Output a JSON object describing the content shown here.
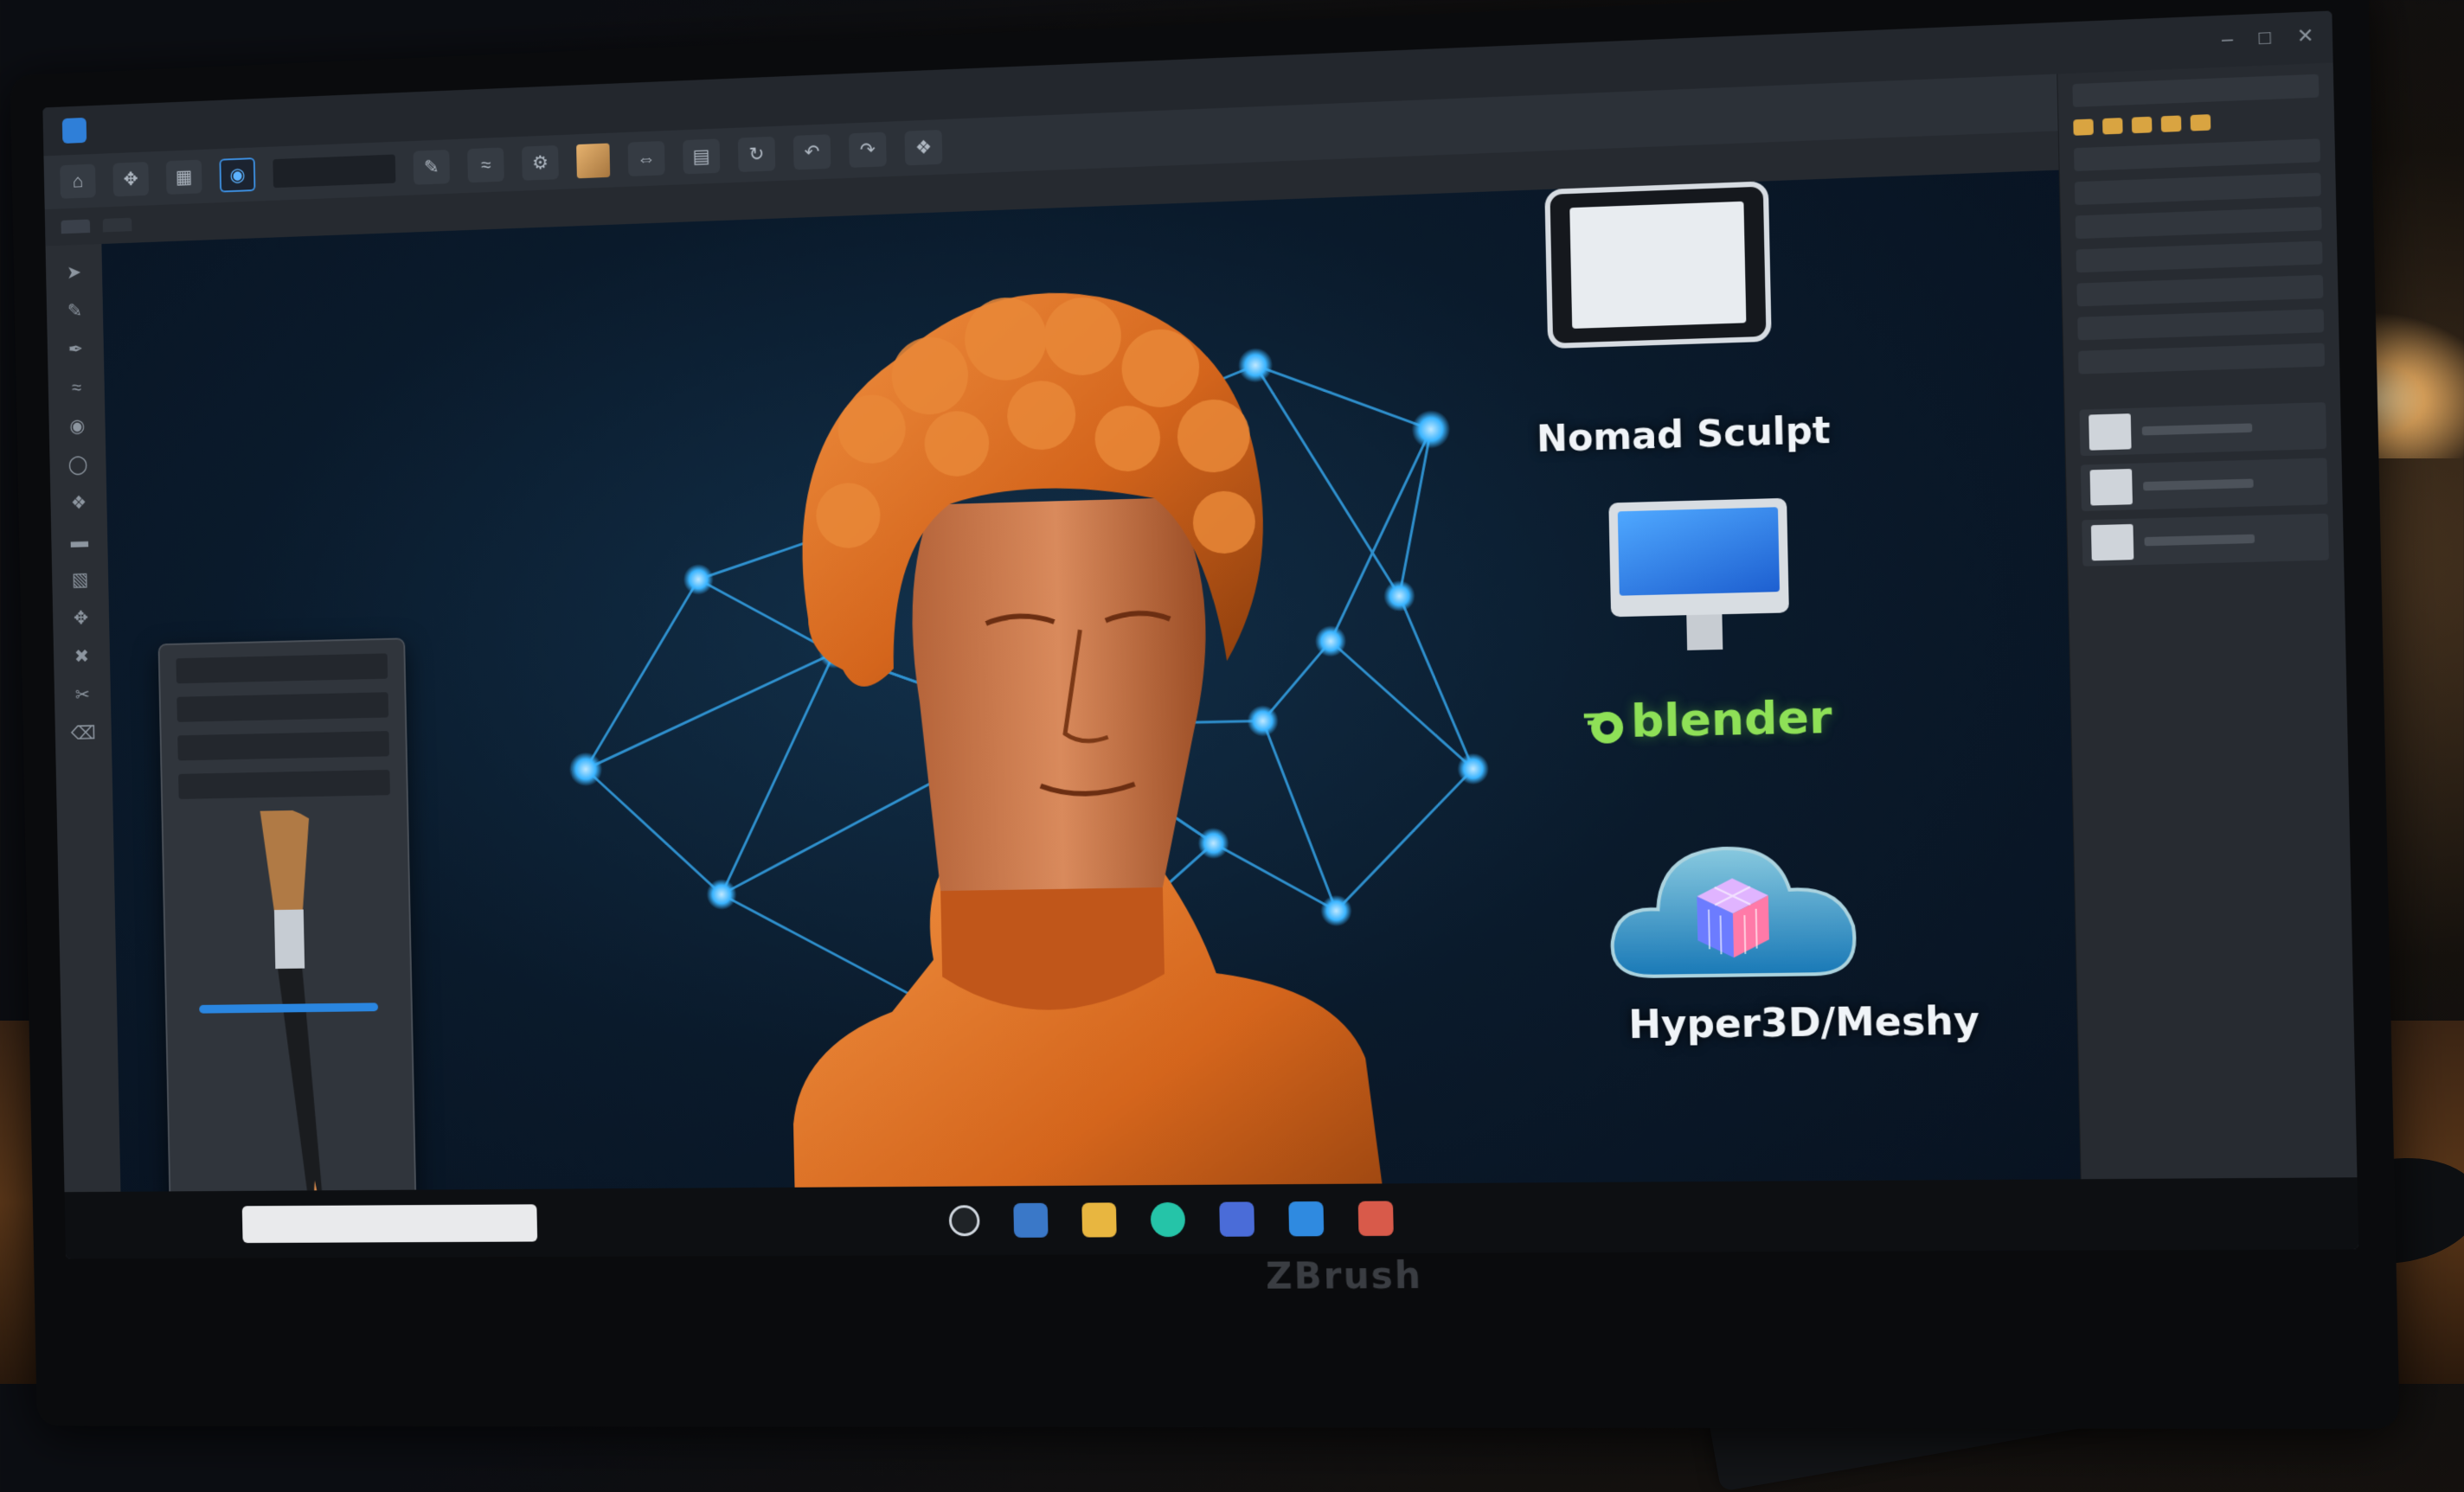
{
  "window": {
    "menu_items": [
      "",
      "",
      "",
      "",
      "",
      "",
      "",
      ""
    ],
    "tabs": [
      "",
      ""
    ]
  },
  "canvas": {
    "apps": [
      {
        "name": "Nomad Sculpt",
        "icon": "tablet-icon"
      },
      {
        "name": "blender",
        "icon": "imac-icon",
        "color": "#8ee057"
      },
      {
        "name": "Hyper3D/Meshy",
        "icon": "cloud-cube-icon"
      }
    ]
  },
  "monitor": {
    "brand": "ZBrush"
  },
  "colors": {
    "accent": "#2a86e0",
    "sculpt": "#e06a1c",
    "network": "#3ab4ff"
  }
}
